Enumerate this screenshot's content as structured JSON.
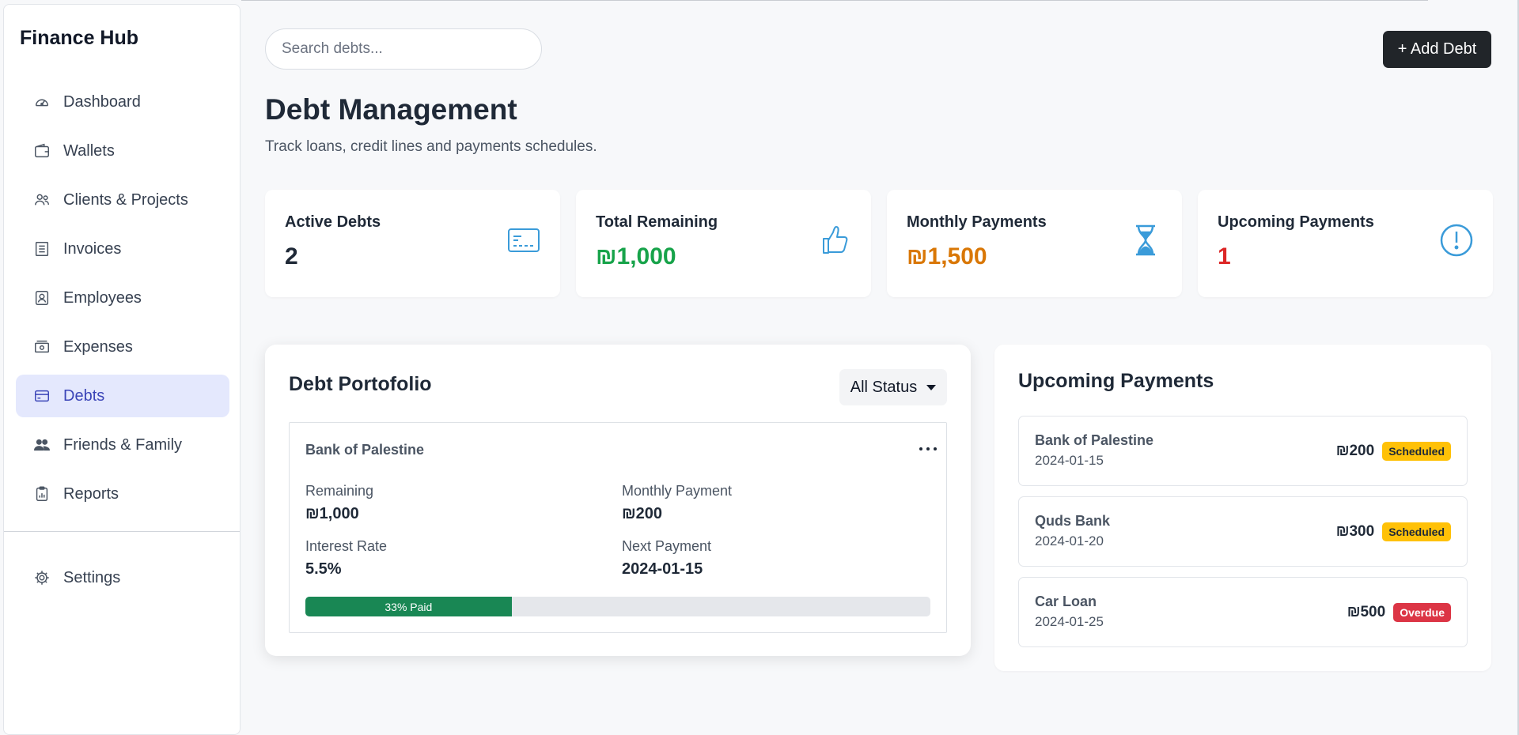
{
  "app": {
    "brand": "Finance Hub"
  },
  "sidebar": {
    "items": [
      {
        "label": "Dashboard",
        "icon": "gauge-icon"
      },
      {
        "label": "Wallets",
        "icon": "wallet-icon"
      },
      {
        "label": "Clients & Projects",
        "icon": "users-icon"
      },
      {
        "label": "Invoices",
        "icon": "receipt-icon"
      },
      {
        "label": "Employees",
        "icon": "person-badge-icon"
      },
      {
        "label": "Expenses",
        "icon": "cash-icon"
      },
      {
        "label": "Debts",
        "icon": "credit-card-icon",
        "active": true
      },
      {
        "label": "Friends & Family",
        "icon": "people-icon"
      },
      {
        "label": "Reports",
        "icon": "clipboard-chart-icon"
      }
    ],
    "settings": {
      "label": "Settings",
      "icon": "gear-icon"
    }
  },
  "header": {
    "search_placeholder": "Search debts...",
    "add_label": "+ Add Debt",
    "title": "Debt Management",
    "subtitle": "Track loans, credit lines and payments schedules."
  },
  "stats": [
    {
      "label": "Active Debts",
      "value": "2",
      "color": "#1f2937",
      "icon": "credit-card-icon",
      "icon_color": "#3a9bd9"
    },
    {
      "label": "Total Remaining",
      "value": "₪1,000",
      "color": "#17a34a",
      "icon": "thumbs-up-icon",
      "icon_color": "#3a9bd9"
    },
    {
      "label": "Monthly Payments",
      "value": "₪1,500",
      "color": "#d97706",
      "icon": "hourglass-icon",
      "icon_color": "#3a9bd9"
    },
    {
      "label": "Upcoming Payments",
      "value": "1",
      "color": "#dc2626",
      "icon": "exclamation-circle-icon",
      "icon_color": "#3a9bd9"
    }
  ],
  "portfolio": {
    "title": "Debt Portofolio",
    "filter_label": "All Status",
    "debt": {
      "name": "Bank of Palestine",
      "remaining_label": "Remaining",
      "remaining": "₪1,000",
      "monthly_label": "Monthly Payment",
      "monthly": "₪200",
      "interest_label": "Interest Rate",
      "interest": "5.5%",
      "next_label": "Next Payment",
      "next": "2024-01-15",
      "progress_percent": 33,
      "progress_label": "33% Paid"
    }
  },
  "upcoming": {
    "title": "Upcoming Payments",
    "items": [
      {
        "name": "Bank of Palestine",
        "date": "2024-01-15",
        "amount": "₪200",
        "status": "Scheduled",
        "status_type": "scheduled"
      },
      {
        "name": "Quds Bank",
        "date": "2024-01-20",
        "amount": "₪300",
        "status": "Scheduled",
        "status_type": "scheduled"
      },
      {
        "name": "Car Loan",
        "date": "2024-01-25",
        "amount": "₪500",
        "status": "Overdue",
        "status_type": "overdue"
      }
    ]
  }
}
